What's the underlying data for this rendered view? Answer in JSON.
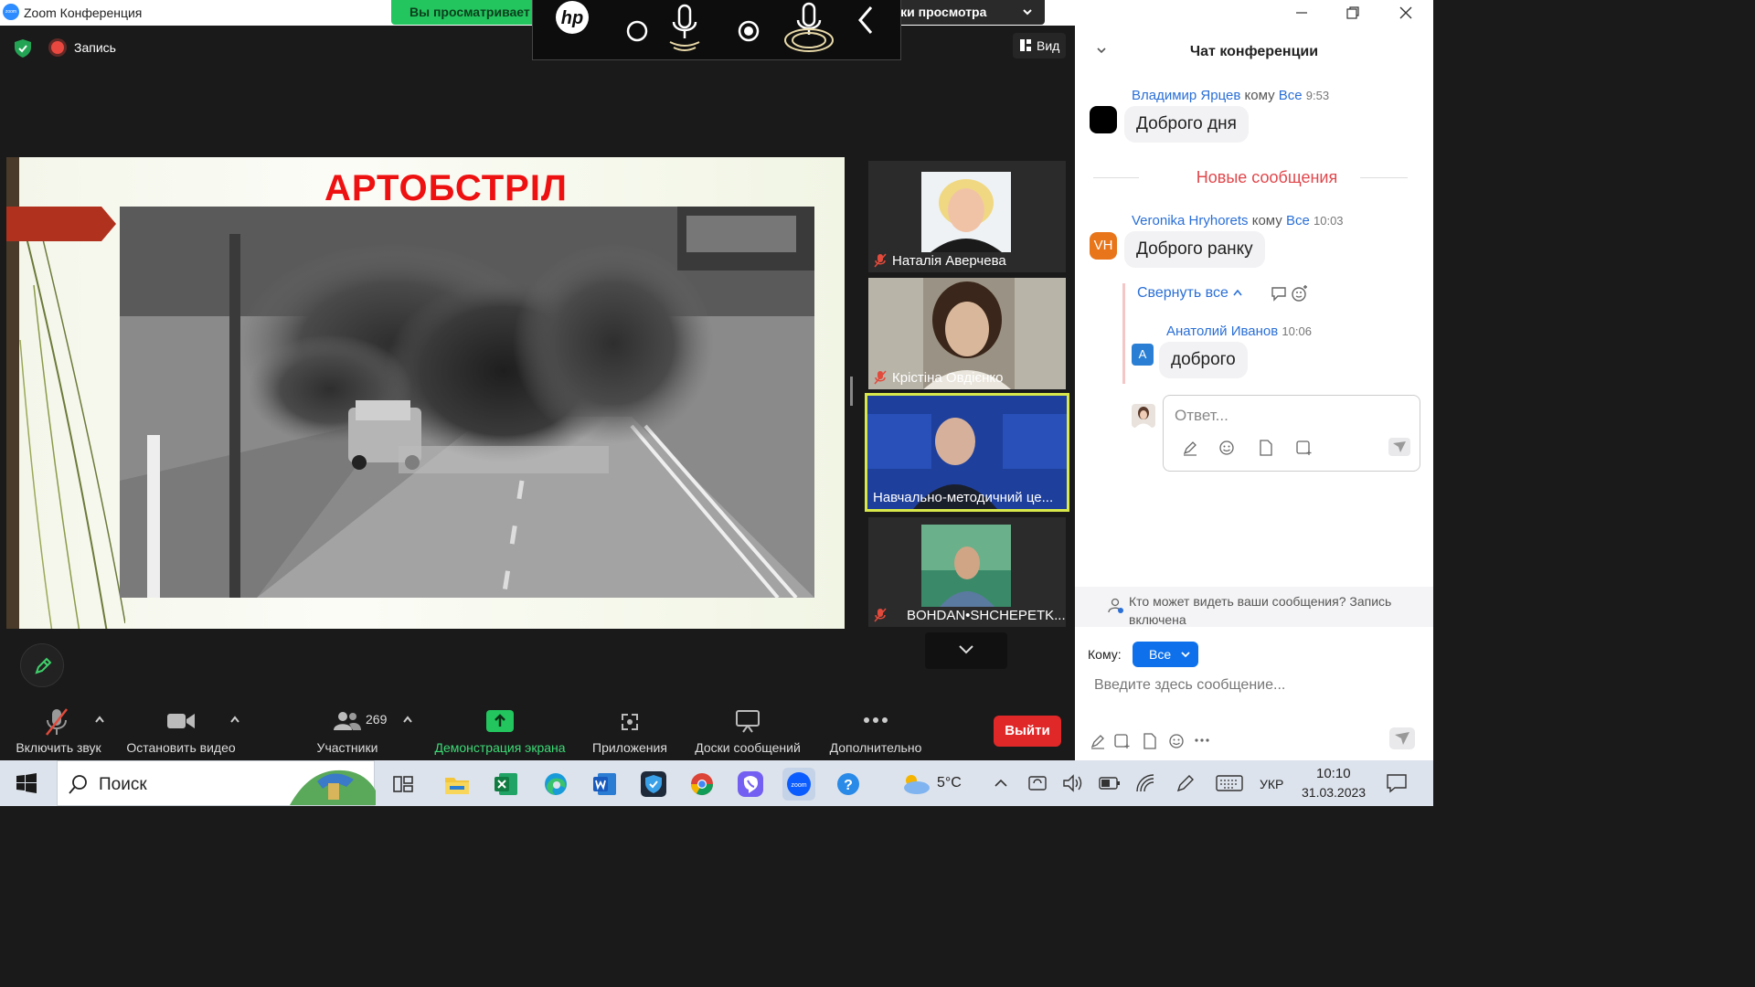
{
  "window": {
    "title": "Zoom Конференция",
    "logo_text": "zoom"
  },
  "meeting": {
    "record_label": "Запись",
    "view_label": "Вид",
    "share_banner": {
      "left_text": "Вы просматривает",
      "right_text": "ойки просмотра"
    },
    "slide": {
      "title": "АРТОБСТРІЛ"
    },
    "participants": [
      {
        "name": "Наталія Аверчева",
        "muted": true
      },
      {
        "name": "Крістіна Овдієнко",
        "muted": true
      },
      {
        "name": "Навчально-методичний це...",
        "muted": false,
        "active_speaker": true
      },
      {
        "name": "BOHDAN•SHCHEPETK...",
        "muted": true
      }
    ]
  },
  "toolbar": {
    "unmute_label": "Включить звук",
    "stop_video_label": "Остановить видео",
    "participants_label": "Участники",
    "participants_count": "269",
    "share_label": "Демонстрация экрана",
    "apps_label": "Приложения",
    "whiteboards_label": "Доски сообщений",
    "more_label": "Дополнительно",
    "exit_label": "Выйти"
  },
  "chat": {
    "title": "Чат конференции",
    "messages": [
      {
        "sender": "Владимир Ярцев",
        "to_word": "кому",
        "to": "Все",
        "time": "9:53",
        "text": "Доброго дня",
        "avatar": ""
      },
      {
        "sender": "Veronika Hryhorets",
        "to_word": "кому",
        "to": "Все",
        "time": "10:03",
        "text": "Доброго ранку",
        "avatar": "VH"
      }
    ],
    "new_messages_label": "Новые сообщения",
    "collapse_all_label": "Свернуть все",
    "thread_reply": {
      "sender": "Анатолий Иванов",
      "time": "10:06",
      "text": "доброго",
      "avatar": "A"
    },
    "reply_placeholder": "Ответ...",
    "info_text": "Кто может видеть ваши сообщения? Запись включена",
    "to_label": "Кому:",
    "to_value": "Все",
    "input_placeholder": "Введите здесь сообщение..."
  },
  "taskbar": {
    "search_label": "Поиск",
    "weather": "5°C",
    "language": "УКР",
    "time": "10:10",
    "date": "31.03.2023"
  },
  "colors": {
    "zoom_blue": "#0e71eb",
    "exit_red": "#e02828",
    "share_green": "#22c55e",
    "new_messages_red": "#e0474c",
    "speaker_border": "#d8e84a"
  }
}
